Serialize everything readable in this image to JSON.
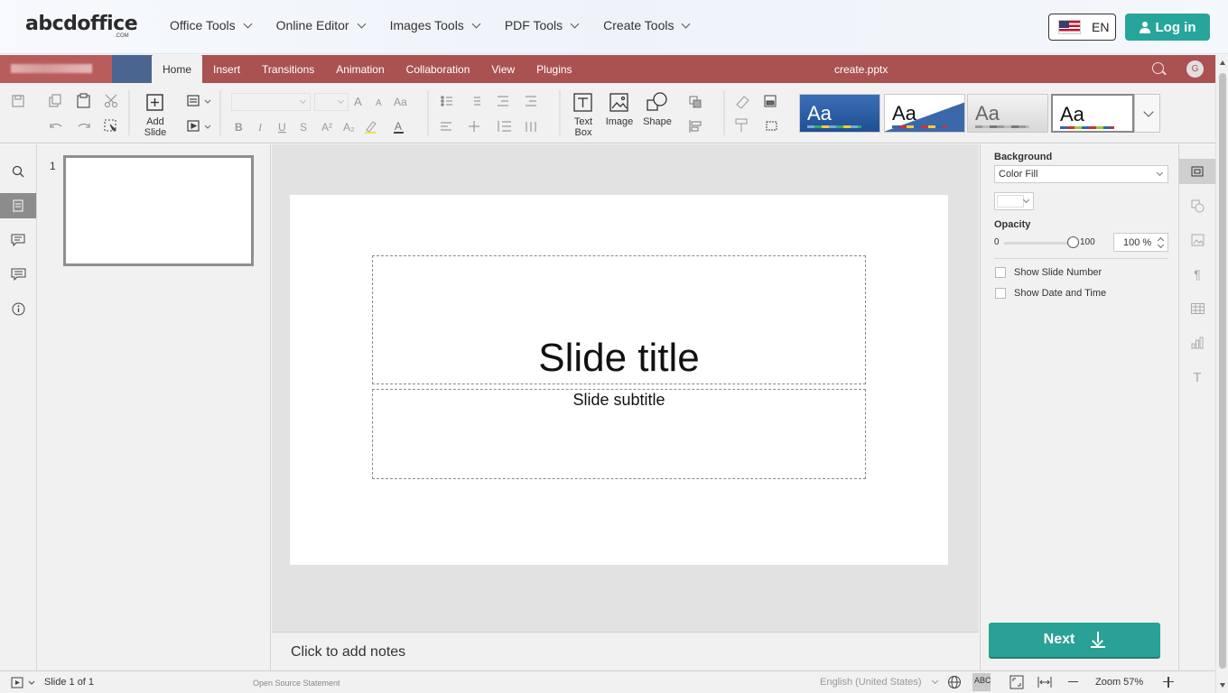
{
  "site": {
    "logo": "abcdoffice",
    "logo_sub": ".COM",
    "menu": [
      "Office Tools",
      "Online Editor",
      "Images Tools",
      "PDF Tools",
      "Create Tools"
    ],
    "language": "EN",
    "login": "Log in"
  },
  "editor": {
    "tabs": [
      "Home",
      "Insert",
      "Transitions",
      "Animation",
      "Collaboration",
      "View",
      "Plugins"
    ],
    "active_tab": "Home",
    "doc_title": "create.pptx",
    "user_initial": "G",
    "accent_color": "#aa5252"
  },
  "toolbar": {
    "add_slide": [
      "Add",
      "Slide"
    ],
    "text_box": [
      "Text",
      "Box"
    ],
    "image": "Image",
    "shape": "Shape",
    "themes": [
      "Aa",
      "Aa",
      "Aa",
      "Aa"
    ]
  },
  "thumbs": {
    "slide_number": "1"
  },
  "slide": {
    "title": "Slide title",
    "subtitle": "Slide subtitle"
  },
  "notes": {
    "placeholder": "Click to add notes"
  },
  "settings": {
    "background_label": "Background",
    "fill_type": "Color Fill",
    "opacity_label": "Opacity",
    "opacity_min": "0",
    "opacity_max": "100",
    "opacity_value": "100 %",
    "opacity_fraction": 1.0,
    "show_slide_number": "Show Slide Number",
    "show_date_time": "Show Date and Time",
    "next_button": "Next"
  },
  "status": {
    "slide_counter": "Slide 1 of 1",
    "open_source": "Open Source Statement",
    "language": "English (United States)",
    "zoom": "Zoom 57%"
  }
}
